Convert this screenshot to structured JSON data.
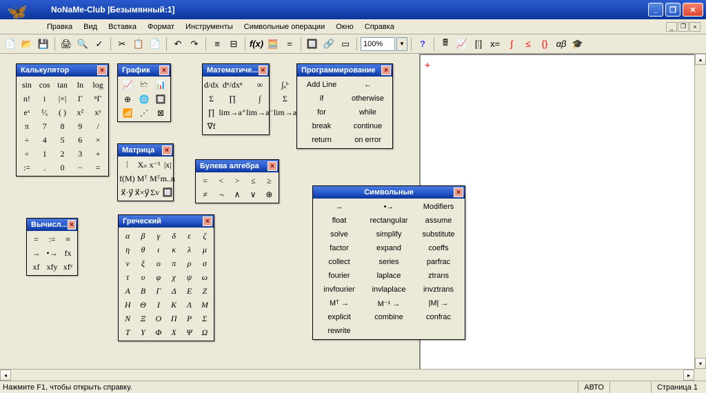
{
  "logo": "NoNaMe-Club",
  "title": "|Безымянный:1]",
  "menubar": [
    "Правка",
    "Вид",
    "Вставка",
    "Формат",
    "Инструменты",
    "Символьные операции",
    "Окно",
    "Справка"
  ],
  "zoom": "100%",
  "status": {
    "hint": "Нажмите F1, чтобы открыть справку.",
    "mode": "АВТО",
    "page": "Страница 1"
  },
  "palettes": {
    "calc": {
      "title": "Калькулятор",
      "cells": [
        "sin",
        "cos",
        "tan",
        "ln",
        "log",
        "n!",
        "i",
        "|×|",
        "Γ",
        "ⁿΓ",
        "eˣ",
        "¹⁄ₓ",
        "( )",
        "x²",
        "xʸ",
        "π",
        "7",
        "8",
        "9",
        "/",
        "÷",
        "4",
        "5",
        "6",
        "×",
        "÷",
        "1",
        "2",
        "3",
        "+",
        ":=",
        ".",
        "0",
        "−",
        "="
      ]
    },
    "graph": {
      "title": "График",
      "cells": [
        "📈",
        "🗠",
        "📊",
        "⊕",
        "🌐",
        "🔲",
        "📶",
        "⋰",
        "⊠"
      ]
    },
    "matrix": {
      "title": "Матрица",
      "cells": [
        "⦙",
        "Xₙ",
        "x⁻¹",
        "|x|",
        "f(M)",
        "Mᵀ",
        "Mᵀ",
        "m..n",
        "x⃗·y⃗",
        "x⃗×y⃗",
        "Σv",
        "🔲"
      ]
    },
    "math": {
      "title": "Математиче...",
      "cells": [
        "d/dx",
        "dⁿ/dxⁿ",
        "∞",
        "∫ₐᵇ",
        "Σ",
        "∏",
        "∫",
        "Σ",
        "∏",
        "lim→a⁺",
        "lim→a⁻",
        "lim→a",
        "∇f"
      ]
    },
    "bool": {
      "title": "Булева алгебра",
      "cells": [
        "=",
        "<",
        ">",
        "≤",
        "≥",
        "≠",
        "¬",
        "∧",
        "∨",
        "⊕"
      ]
    },
    "prog": {
      "title": "Программирование",
      "rows": [
        [
          "Add Line",
          "←"
        ],
        [
          "if",
          "otherwise"
        ],
        [
          "for",
          "while"
        ],
        [
          "break",
          "continue"
        ],
        [
          "return",
          "on error"
        ]
      ]
    },
    "eval": {
      "title": "Вычисл...",
      "cells": [
        "=",
        ":=",
        "≡",
        "→",
        "•→",
        "fx",
        "xf",
        "xfy",
        "xfʸ"
      ]
    },
    "greek": {
      "title": "Греческий",
      "cells": [
        "α",
        "β",
        "γ",
        "δ",
        "ε",
        "ζ",
        "η",
        "θ",
        "ι",
        "κ",
        "λ",
        "μ",
        "ν",
        "ξ",
        "ο",
        "π",
        "ρ",
        "σ",
        "τ",
        "υ",
        "φ",
        "χ",
        "ψ",
        "ω",
        "Α",
        "Β",
        "Γ",
        "Δ",
        "Ε",
        "Ζ",
        "Η",
        "Θ",
        "Ι",
        "Κ",
        "Λ",
        "Μ",
        "Ν",
        "Ξ",
        "Ο",
        "Π",
        "Ρ",
        "Σ",
        "Τ",
        "Υ",
        "Φ",
        "Χ",
        "Ψ",
        "Ω"
      ]
    },
    "symb": {
      "title": "Символьные",
      "rows": [
        [
          "→",
          "•→",
          "Modifiers"
        ],
        [
          "float",
          "rectangular",
          "assume"
        ],
        [
          "solve",
          "simplify",
          "substitute"
        ],
        [
          "factor",
          "expand",
          "coeffs"
        ],
        [
          "collect",
          "series",
          "parfrac"
        ],
        [
          "fourier",
          "laplace",
          "ztrans"
        ],
        [
          "invfourier",
          "invlaplace",
          "invztrans"
        ],
        [
          "Mᵀ →",
          "M⁻¹ →",
          "|M| →"
        ],
        [
          "explicit",
          "combine",
          "confrac"
        ],
        [
          "rewrite",
          "",
          ""
        ]
      ]
    }
  }
}
